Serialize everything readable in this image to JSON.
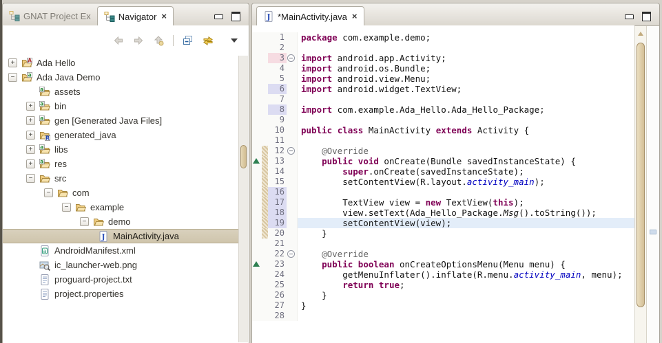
{
  "glyphs": {
    "plus": "+",
    "minus": "−",
    "close": "×"
  },
  "colors": {
    "keyword": "#7f0055",
    "static_ref": "#0000c0",
    "annotation_text": "#646464",
    "tree_selection": "#d4cbb2",
    "current_line": "#e3edf9",
    "diff_bar": "#d8c6a0"
  },
  "left_panel": {
    "tabs": [
      {
        "label": "GNAT Project Ex",
        "active": false
      },
      {
        "label": "Navigator",
        "active": true,
        "closable": true
      }
    ],
    "toolbar_icons": [
      "back",
      "forward",
      "up",
      "collapse-all",
      "link-with-editor",
      "view-menu"
    ],
    "tree": [
      {
        "label": "Ada Hello",
        "depth": 0,
        "expander": "plus",
        "icon": "project-ada"
      },
      {
        "label": "Ada Java Demo",
        "depth": 0,
        "expander": "minus",
        "icon": "project-java"
      },
      {
        "label": "assets",
        "depth": 1,
        "expander": "none",
        "icon": "folder-badge"
      },
      {
        "label": "bin",
        "depth": 1,
        "expander": "plus",
        "icon": "folder-badge"
      },
      {
        "label": "gen [Generated Java Files]",
        "depth": 1,
        "expander": "plus",
        "icon": "folder-badge"
      },
      {
        "label": "generated_java",
        "depth": 1,
        "expander": "plus",
        "icon": "folder-r"
      },
      {
        "label": "libs",
        "depth": 1,
        "expander": "plus",
        "icon": "folder-badge"
      },
      {
        "label": "res",
        "depth": 1,
        "expander": "plus",
        "icon": "folder-badge"
      },
      {
        "label": "src",
        "depth": 1,
        "expander": "minus",
        "icon": "folder"
      },
      {
        "label": "com",
        "depth": 2,
        "expander": "minus",
        "icon": "folder"
      },
      {
        "label": "example",
        "depth": 3,
        "expander": "minus",
        "icon": "folder"
      },
      {
        "label": "demo",
        "depth": 4,
        "expander": "minus",
        "icon": "folder"
      },
      {
        "label": "MainActivity.java",
        "depth": 5,
        "expander": "none",
        "icon": "java-file",
        "selected": true
      },
      {
        "label": "AndroidManifest.xml",
        "depth": 1,
        "expander": "none",
        "icon": "xml-file"
      },
      {
        "label": "ic_launcher-web.png",
        "depth": 1,
        "expander": "none",
        "icon": "image-file"
      },
      {
        "label": "proguard-project.txt",
        "depth": 1,
        "expander": "none",
        "icon": "text-file"
      },
      {
        "label": "project.properties",
        "depth": 1,
        "expander": "none",
        "icon": "text-file"
      }
    ]
  },
  "editor": {
    "tab": {
      "label": "*MainActivity.java",
      "closable": true
    },
    "code": {
      "lines": [
        {
          "n": 1,
          "tokens": [
            [
              "kw",
              "package"
            ],
            [
              "pl",
              " com.example.demo;"
            ]
          ]
        },
        {
          "n": 2,
          "tokens": []
        },
        {
          "n": 3,
          "fold": true,
          "num": "pink",
          "tokens": [
            [
              "kw",
              "import"
            ],
            [
              "pl",
              " android.app.Activity;"
            ]
          ]
        },
        {
          "n": 4,
          "underline": true,
          "tokens": [
            [
              "kw",
              "import"
            ],
            [
              "pl",
              " android.os.Bundle;"
            ]
          ]
        },
        {
          "n": 5,
          "tokens": [
            [
              "kw",
              "import"
            ],
            [
              "pl",
              " android.view.Menu;"
            ]
          ]
        },
        {
          "n": 6,
          "num": "lav",
          "tokens": [
            [
              "kw",
              "import"
            ],
            [
              "pl",
              " android.widget.TextView;"
            ]
          ]
        },
        {
          "n": 7,
          "tokens": []
        },
        {
          "n": 8,
          "num": "lav",
          "tokens": [
            [
              "kw",
              "import"
            ],
            [
              "pl",
              " com.example.Ada_Hello.Ada_Hello_Package;"
            ]
          ]
        },
        {
          "n": 9,
          "tokens": []
        },
        {
          "n": 10,
          "tokens": [
            [
              "kw",
              "public"
            ],
            [
              "pl",
              " "
            ],
            [
              "kw",
              "class"
            ],
            [
              "pl",
              " MainActivity "
            ],
            [
              "kw",
              "extends"
            ],
            [
              "pl",
              " Activity {"
            ]
          ]
        },
        {
          "n": 11,
          "tokens": []
        },
        {
          "n": 12,
          "fold": true,
          "diff": true,
          "tokens": [
            [
              "pl",
              "    "
            ],
            [
              "ann",
              "@Override"
            ]
          ]
        },
        {
          "n": 13,
          "diff": true,
          "marker": true,
          "tokens": [
            [
              "pl",
              "    "
            ],
            [
              "kw",
              "public"
            ],
            [
              "pl",
              " "
            ],
            [
              "kw",
              "void"
            ],
            [
              "pl",
              " onCreate(Bundle savedInstanceState) {"
            ]
          ]
        },
        {
          "n": 14,
          "diff": true,
          "tokens": [
            [
              "pl",
              "        "
            ],
            [
              "kw",
              "super"
            ],
            [
              "pl",
              ".onCreate(savedInstanceState);"
            ]
          ]
        },
        {
          "n": 15,
          "diff": true,
          "tokens": [
            [
              "pl",
              "        setContentView(R.layout."
            ],
            [
              "sf",
              "activity_main"
            ],
            [
              "pl",
              ");"
            ]
          ]
        },
        {
          "n": 16,
          "diff": true,
          "num": "lav",
          "tokens": []
        },
        {
          "n": 17,
          "diff": true,
          "num": "lav",
          "tokens": [
            [
              "pl",
              "        TextView view = "
            ],
            [
              "kw",
              "new"
            ],
            [
              "pl",
              " TextView("
            ],
            [
              "kw",
              "this"
            ],
            [
              "pl",
              ");"
            ]
          ]
        },
        {
          "n": 18,
          "diff": true,
          "num": "lav",
          "tokens": [
            [
              "pl",
              "        view.setText(Ada_Hello_Package."
            ],
            [
              "im",
              "Msg"
            ],
            [
              "pl",
              "().toString());"
            ]
          ]
        },
        {
          "n": 19,
          "diff": true,
          "num": "lav",
          "current": true,
          "tokens": [
            [
              "pl",
              "        setContentView(view);"
            ]
          ]
        },
        {
          "n": 20,
          "diff": true,
          "tokens": [
            [
              "pl",
              "    }"
            ]
          ]
        },
        {
          "n": 21,
          "tokens": []
        },
        {
          "n": 22,
          "fold": true,
          "tokens": [
            [
              "pl",
              "    "
            ],
            [
              "ann",
              "@Override"
            ]
          ]
        },
        {
          "n": 23,
          "marker": true,
          "tokens": [
            [
              "pl",
              "    "
            ],
            [
              "kw",
              "public"
            ],
            [
              "pl",
              " "
            ],
            [
              "kw",
              "boolean"
            ],
            [
              "pl",
              " onCreateOptionsMenu(Menu menu) {"
            ]
          ]
        },
        {
          "n": 24,
          "tokens": [
            [
              "pl",
              "        getMenuInflater().inflate(R.menu."
            ],
            [
              "sf",
              "activity_main"
            ],
            [
              "pl",
              ", menu);"
            ]
          ]
        },
        {
          "n": 25,
          "tokens": [
            [
              "pl",
              "        "
            ],
            [
              "kw",
              "return"
            ],
            [
              "pl",
              " "
            ],
            [
              "kw",
              "true"
            ],
            [
              "pl",
              ";"
            ]
          ]
        },
        {
          "n": 26,
          "tokens": [
            [
              "pl",
              "    }"
            ]
          ]
        },
        {
          "n": 27,
          "tokens": [
            [
              "pl",
              "}"
            ]
          ]
        },
        {
          "n": 28,
          "tokens": []
        }
      ]
    }
  }
}
